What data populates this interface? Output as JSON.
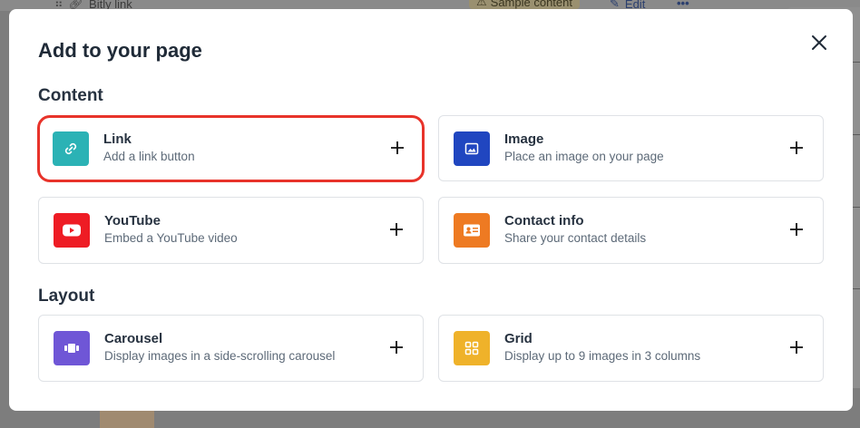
{
  "background": {
    "link_label": "Bitly link",
    "badge_label": "Sample content",
    "edit_label": "Edit"
  },
  "modal": {
    "title": "Add to your page",
    "sections": [
      {
        "title": "Content",
        "cards": [
          {
            "label": "Link",
            "desc": "Add a link button",
            "icon": "link-icon",
            "color": "#2bb2b5"
          },
          {
            "label": "Image",
            "desc": "Place an image on your page",
            "icon": "image-icon",
            "color": "#2046c0"
          },
          {
            "label": "YouTube",
            "desc": "Embed a YouTube video",
            "icon": "youtube-icon",
            "color": "#ee1c24"
          },
          {
            "label": "Contact info",
            "desc": "Share your contact details",
            "icon": "contact-card-icon",
            "color": "#ee7a22"
          }
        ]
      },
      {
        "title": "Layout",
        "cards": [
          {
            "label": "Carousel",
            "desc": "Display images in a side-scrolling carousel",
            "icon": "carousel-icon",
            "color": "#6f56d6"
          },
          {
            "label": "Grid",
            "desc": "Display up to 9 images in 3 columns",
            "icon": "grid-icon",
            "color": "#efb22a"
          }
        ]
      }
    ]
  }
}
